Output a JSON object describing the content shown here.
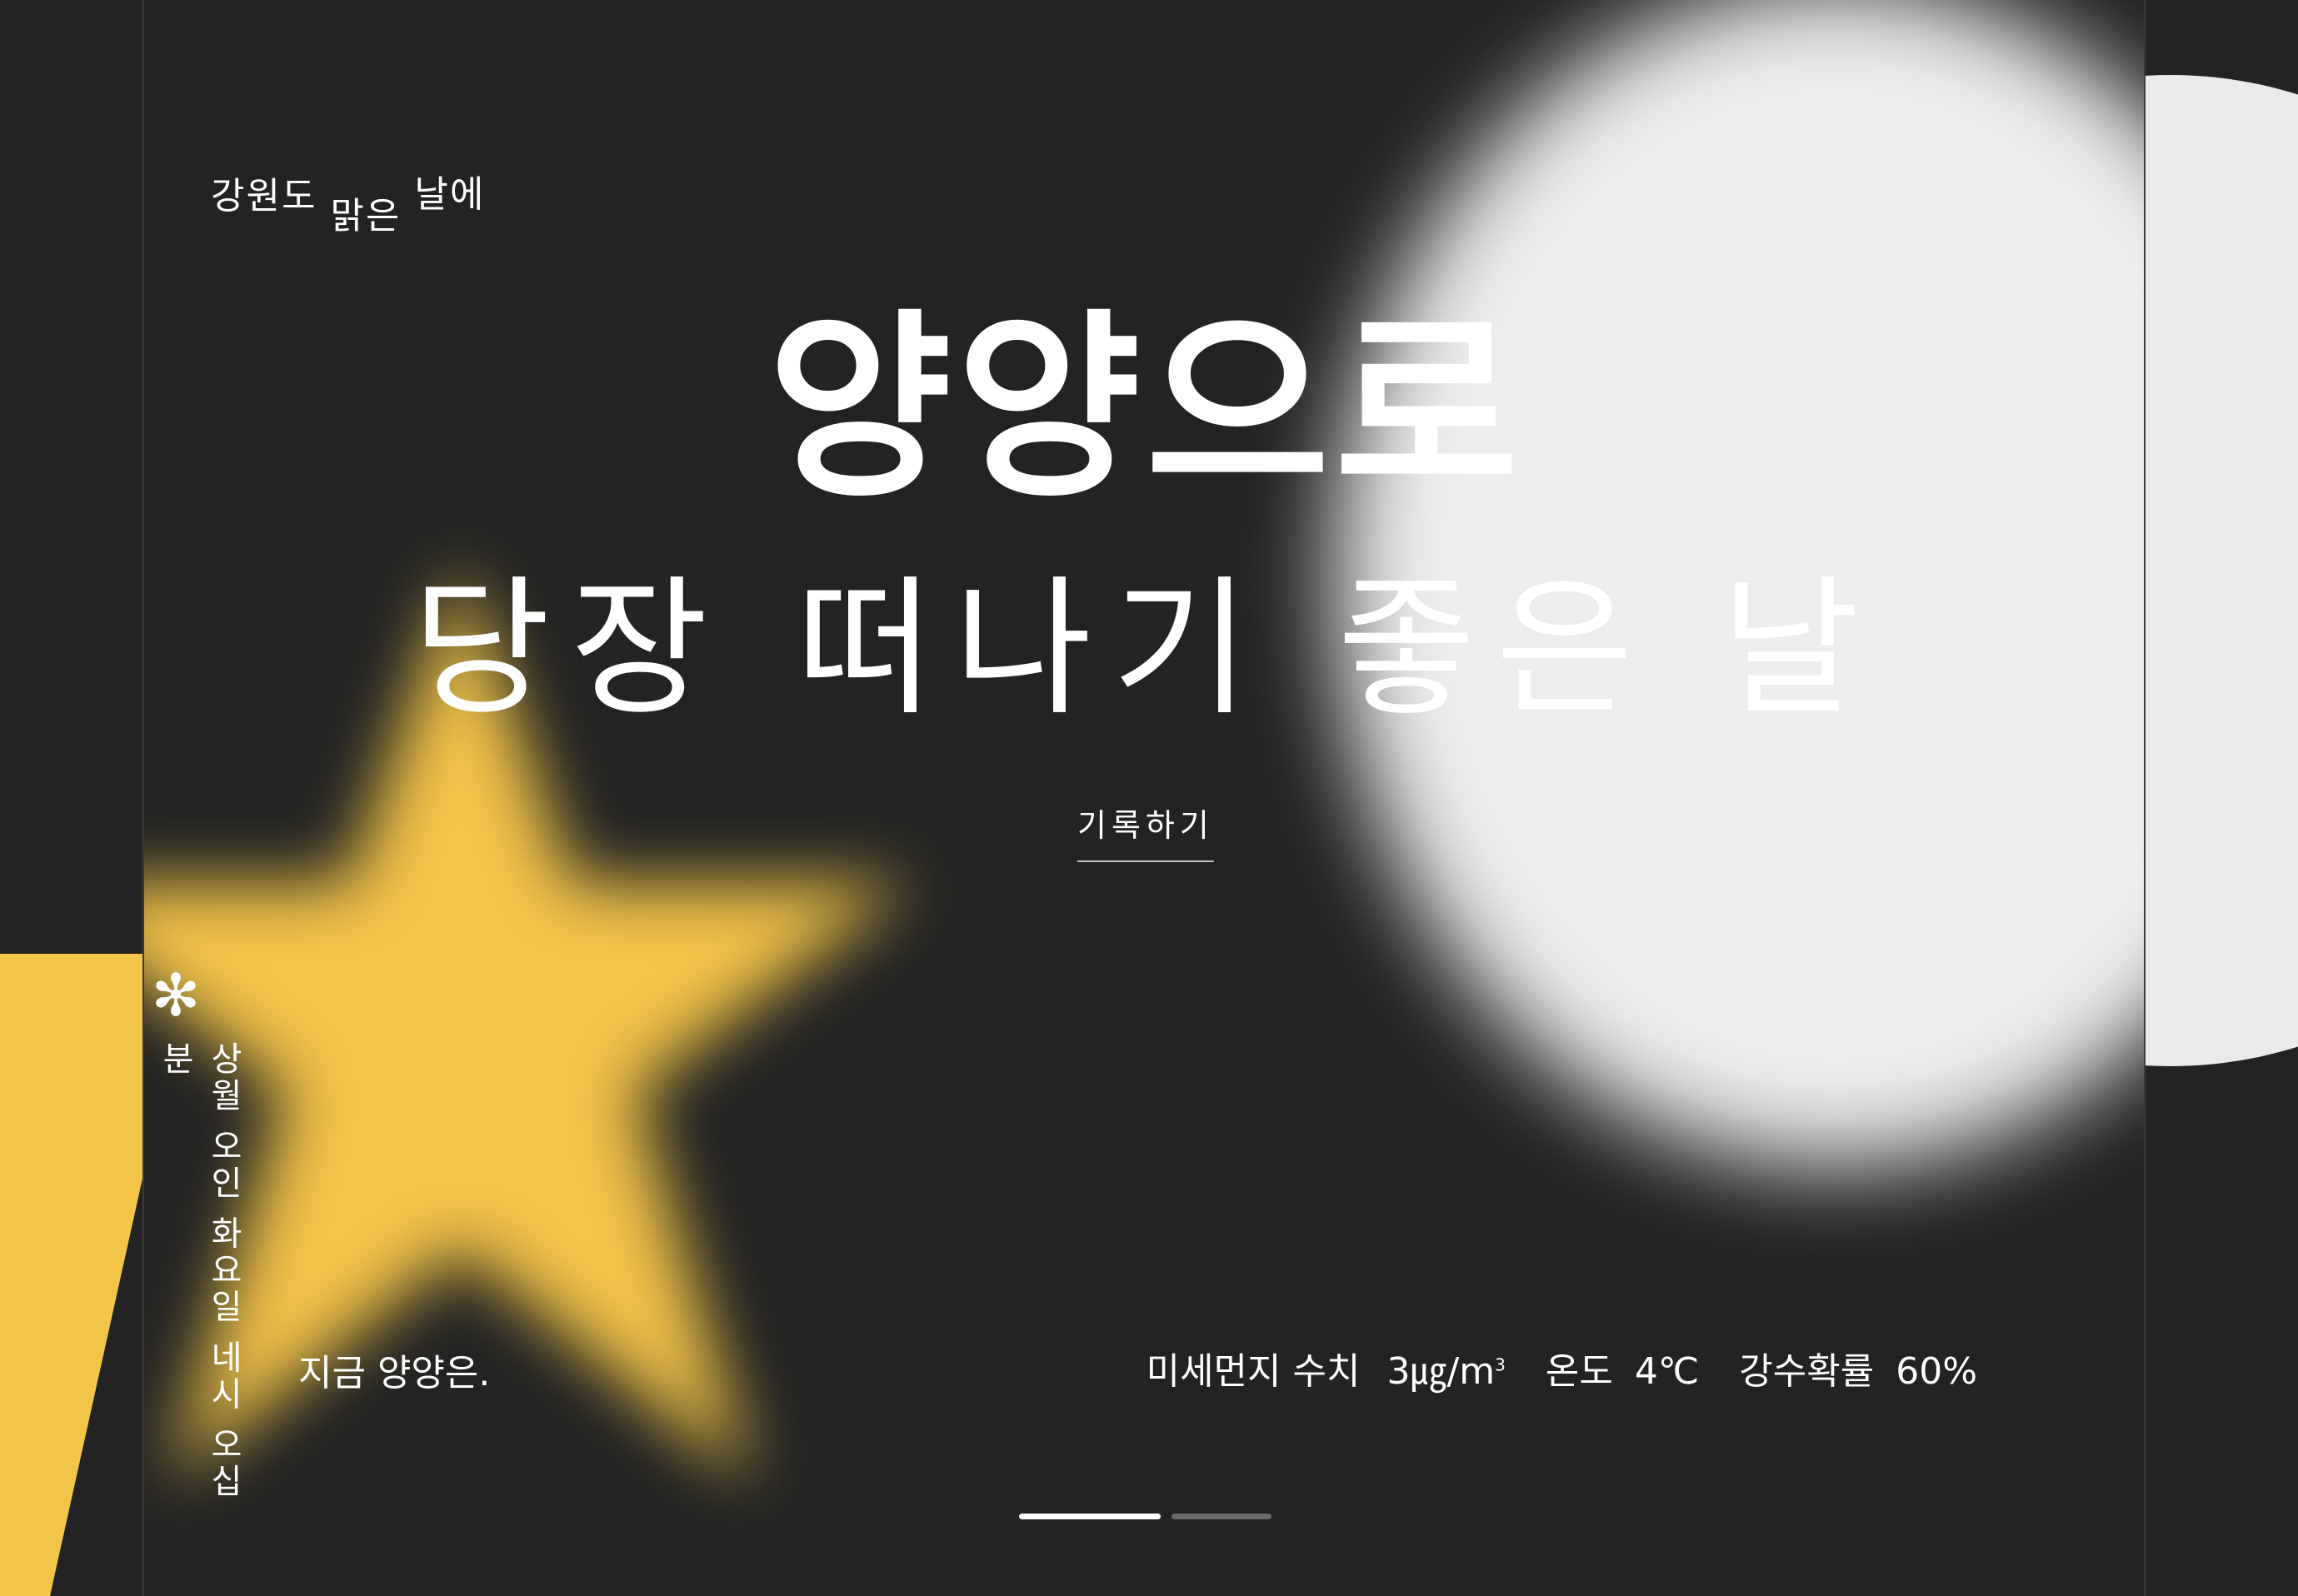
{
  "hero": {
    "eyebrow": [
      "강원도",
      "맑은",
      "날에"
    ],
    "title_line1": "양양으로",
    "title_line2": "당장 떠나기 좋은 날",
    "cta_label": "기록하기"
  },
  "weather": {
    "label": "지금 양양은.",
    "dust_label": "미세먼지 수치",
    "dust_value": "3㎍/m",
    "dust_sup": "3",
    "temp_label": "온도",
    "temp_value": "4℃",
    "rain_label": "강수확률",
    "rain_value": "60%"
  },
  "side_caption": "상월 오인 화요일 네시 오십분",
  "pager": {
    "total": 2,
    "active_index": 0
  },
  "colors": {
    "background": "#232323",
    "star": "#f2c548",
    "moon": "#eeedeb",
    "text": "#ffffff"
  }
}
